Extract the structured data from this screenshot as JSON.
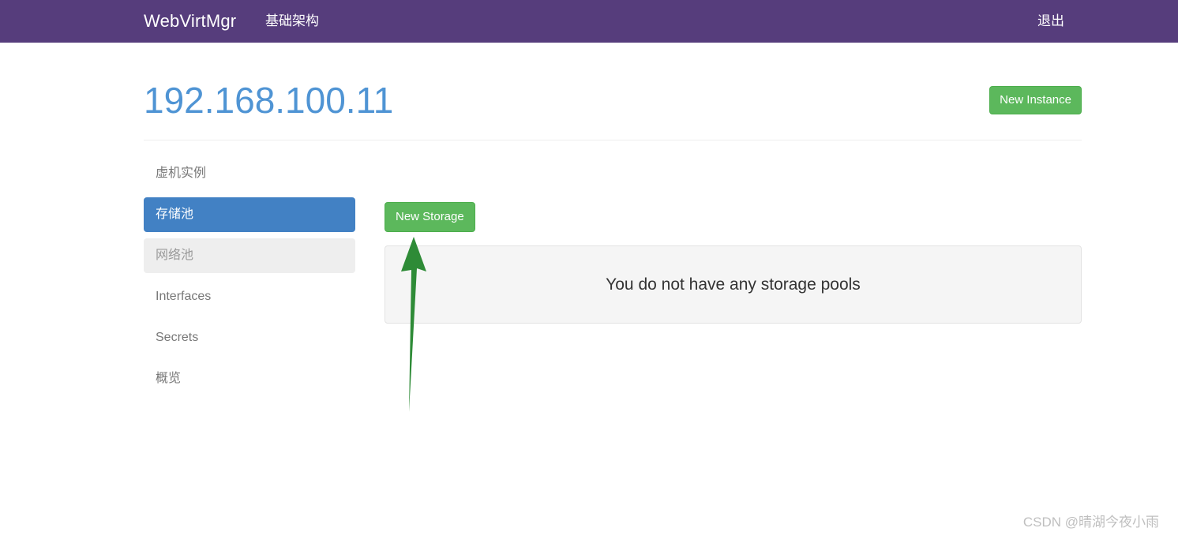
{
  "navbar": {
    "brand": "WebVirtMgr",
    "links": [
      {
        "label": "基础架构",
        "name": "nav-link-infrastructure"
      }
    ],
    "logout_label": "退出",
    "background_color": "#563d7c"
  },
  "header": {
    "title": "192.168.100.11",
    "title_color": "#4f94d4",
    "new_instance_label": "New Instance",
    "accent_green": "#5cb85c"
  },
  "sidebar": {
    "items": [
      {
        "label": "虚机实例",
        "state": "default"
      },
      {
        "label": "存储池",
        "state": "active"
      },
      {
        "label": "网络池",
        "state": "hover"
      },
      {
        "label": "Interfaces",
        "state": "default"
      },
      {
        "label": "Secrets",
        "state": "default"
      },
      {
        "label": "概览",
        "state": "default"
      }
    ],
    "active_color": "#4281c4",
    "hover_color": "#eeeeee"
  },
  "main": {
    "new_storage_label": "New Storage",
    "empty_state_message": "You do not have any storage pools",
    "panel_background": "#f5f5f5",
    "panel_border": "#e3e3e3"
  },
  "annotation": {
    "arrow_color": "#2e8b37",
    "arrow_direction": "up",
    "points_to": "New Storage"
  },
  "watermark": {
    "text": "CSDN @晴湖今夜小雨",
    "color": "#bfbfbf"
  }
}
